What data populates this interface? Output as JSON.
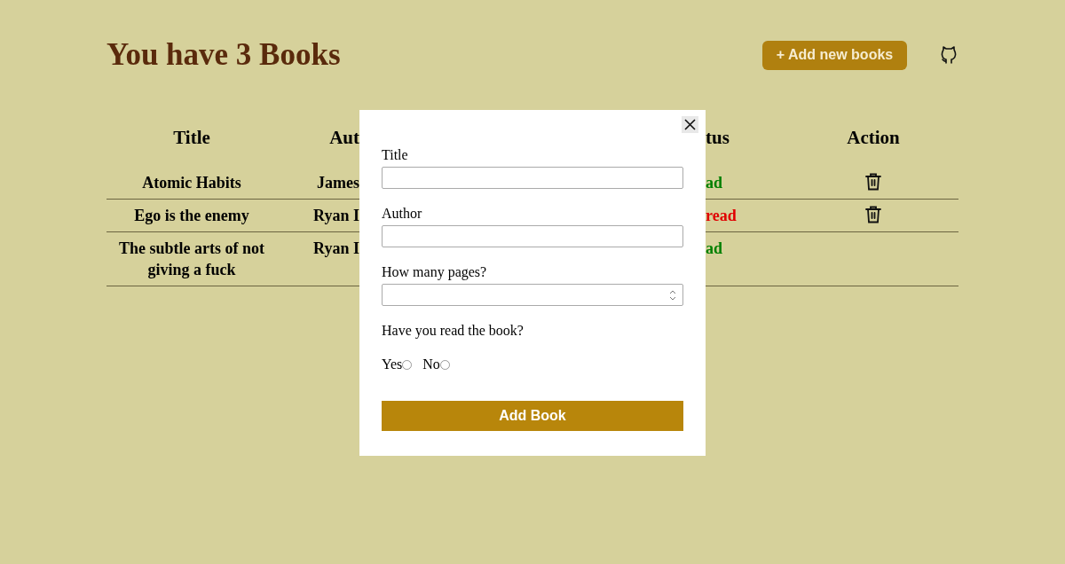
{
  "heading": "You have 3 Books",
  "add_button": "+ Add new books",
  "table": {
    "columns": [
      "Title",
      "Aut",
      "tus",
      "Action"
    ],
    "rows": [
      {
        "title": "Atomic Habits",
        "author": "James",
        "status": "ad",
        "color": "#008000",
        "deletable": true
      },
      {
        "title": "Ego is the enemy",
        "author": "Ryan I",
        "status": "read",
        "color": "#e00000",
        "deletable": true
      },
      {
        "title": "The subtle arts of not giving a fuck",
        "author": "Ryan I",
        "status": "ad",
        "color": "#008000",
        "deletable": false
      }
    ]
  },
  "modal": {
    "fields": [
      {
        "label": "Title",
        "kind": "text"
      },
      {
        "label": "Author",
        "kind": "text"
      },
      {
        "label": "How many pages?",
        "kind": "number"
      }
    ],
    "question": "Have you read the book?",
    "options": [
      {
        "label": "Yes",
        "selected": false
      },
      {
        "label": "No",
        "selected": false
      }
    ],
    "submit": "Add Book"
  }
}
